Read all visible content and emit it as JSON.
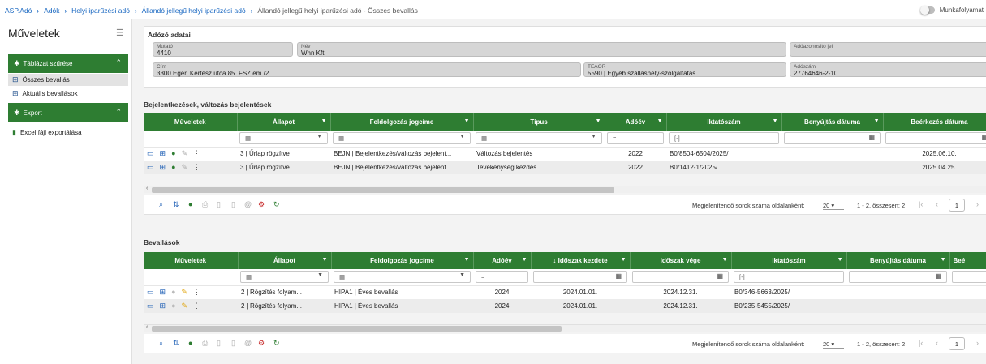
{
  "breadcrumb": {
    "items": [
      "ASP.Adó",
      "Adók",
      "Helyi iparűzési adó",
      "Állandó jellegű helyi iparűzési adó"
    ],
    "current": "Állandó jellegű helyi iparűzési adó - Összes bevallás"
  },
  "workflow_label": "Munkafolyamat",
  "sidebar": {
    "title": "Műveletek",
    "sections": [
      {
        "label": "Táblázat szűrése",
        "items": [
          "Összes bevallás",
          "Aktuális bevallások"
        ]
      },
      {
        "label": "Export",
        "items": [
          "Excel fájl exportálása"
        ]
      }
    ]
  },
  "taxpayer": {
    "title": "Adózó adatai",
    "fields": {
      "mutato": {
        "label": "Mutató",
        "value": "4410"
      },
      "nev": {
        "label": "Név",
        "value": "Whn Kft."
      },
      "adoazon": {
        "label": "Adóazonosító jel",
        "value": ""
      },
      "cim": {
        "label": "Cím",
        "value": "3300 Eger, Kertész utca 85. FSZ em./2"
      },
      "teaor": {
        "label": "TEAOR",
        "value": "5590 | Egyéb szálláshely-szolgáltatás"
      },
      "adoszam": {
        "label": "Adószám",
        "value": "27764646-2-10"
      }
    }
  },
  "grid1": {
    "title": "Bejelentkezések, változás bejelentések",
    "headers": [
      "Műveletek",
      "Állapot",
      "Feldolgozás jogcíme",
      "Típus",
      "Adóév",
      "Iktatószám",
      "Benyújtás dátuma",
      "Beérkezés dátuma"
    ],
    "filters": {
      "eq": "=",
      "tag": "[-]"
    },
    "rows": [
      {
        "allapot": "3 | Űrlap rögzítve",
        "jogcim": "BEJN | Bejelentkezés/változás bejelent...",
        "tipus": "Változás bejelentés",
        "adoev": "2022",
        "iktato": "B0/8504-6504/2025/",
        "benyujtas": "",
        "beerkezes": "2025.06.10."
      },
      {
        "allapot": "3 | Űrlap rögzítve",
        "jogcim": "BEJN | Bejelentkezés/változás bejelent...",
        "tipus": "Tevékenység kezdés",
        "adoev": "2022",
        "iktato": "B0/1412-1/2025/",
        "benyujtas": "",
        "beerkezes": "2025.04.25."
      }
    ],
    "pager": {
      "label": "Megjelenítendő sorok száma oldalanként:",
      "size": "20",
      "range": "1 - 2, összesen: 2",
      "page": "1"
    }
  },
  "grid2": {
    "title": "Bevallások",
    "headers": [
      "Műveletek",
      "Állapot",
      "Feldolgozás jogcíme",
      "Adóév",
      "Időszak kezdete",
      "Időszak vége",
      "Iktatószám",
      "Benyújtás dátuma",
      "Beé"
    ],
    "filters": {
      "eq": "=",
      "tag": "[-]"
    },
    "rows": [
      {
        "allapot": "2 | Rögzítés folyam...",
        "jogcim": "HIPA1 | Éves bevallás",
        "adoev": "2024",
        "kezdete": "2024.01.01.",
        "vege": "2024.12.31.",
        "iktato": "B0/346-5663/2025/"
      },
      {
        "allapot": "2 | Rögzítés folyam...",
        "jogcim": "HIPA1 | Éves bevallás",
        "adoev": "2024",
        "kezdete": "2024.01.01.",
        "vege": "2024.12.31.",
        "iktato": "B0/235-5455/2025/"
      }
    ],
    "pager": {
      "label": "Megjelenítendő sorok száma oldalanként:",
      "size": "20",
      "range": "1 - 2, összesen: 2",
      "page": "1"
    }
  },
  "colors": {
    "accent": "#2e7d32",
    "link": "#1565c0",
    "selected": "#e3e3e3"
  }
}
